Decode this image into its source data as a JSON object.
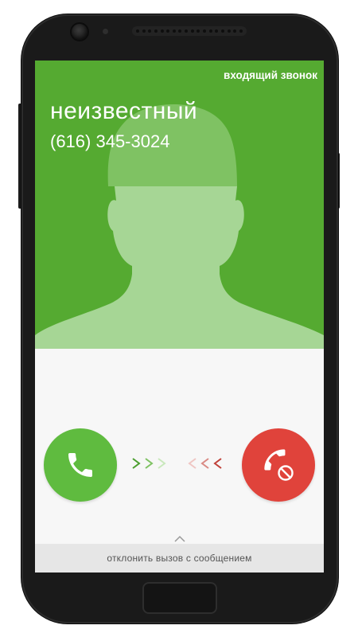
{
  "call": {
    "status_label": "входящий звонок",
    "caller_name": "неизвестный",
    "caller_number": "(616) 345-3024"
  },
  "actions": {
    "answer_icon": "phone-icon",
    "decline_icon": "phone-hangup-blocked-icon",
    "reject_with_message_label": "отклонить вызов с сообщением"
  },
  "colors": {
    "contact_background": "#55aa31",
    "answer": "#5fbb3f",
    "decline": "#e0433b"
  }
}
